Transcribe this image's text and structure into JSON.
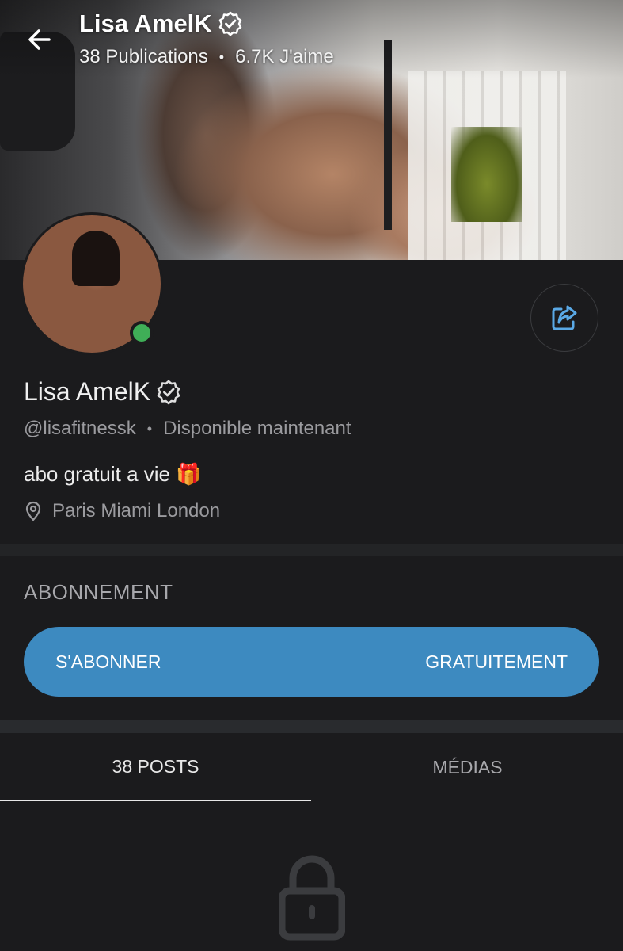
{
  "header": {
    "title": "Lisa AmelK",
    "publications": "38 Publications",
    "likes": "6.7K J'aime"
  },
  "profile": {
    "name": "Lisa AmelK",
    "handle": "@lisafitnessk",
    "status": "Disponible maintenant",
    "bio": "abo gratuit a vie 🎁",
    "location": "Paris Miami London"
  },
  "subscription": {
    "section_title": "ABONNEMENT",
    "button_left": "S'ABONNER",
    "button_right": "GRATUITEMENT"
  },
  "tabs": [
    {
      "label": "38 POSTS",
      "active": true
    },
    {
      "label": "MÉDIAS",
      "active": false
    }
  ],
  "colors": {
    "background": "#1b1b1d",
    "accent": "#3d8ac0",
    "online": "#3fae57",
    "share_icon": "#5aa9e6"
  },
  "icons": [
    "arrow-left-icon",
    "verified-badge-icon",
    "share-icon",
    "location-pin-icon",
    "lock-icon"
  ]
}
